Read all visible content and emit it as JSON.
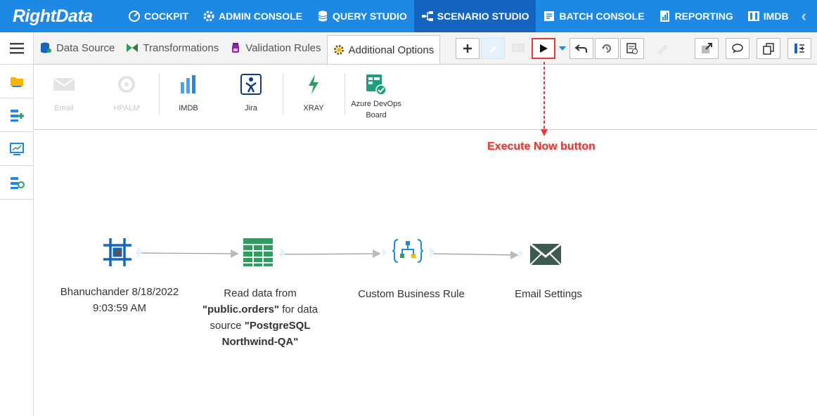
{
  "brand": {
    "name": "RightData"
  },
  "nav": {
    "items": [
      {
        "label": "COCKPIT",
        "icon": "gauge-icon"
      },
      {
        "label": "ADMIN CONSOLE",
        "icon": "gear-icon"
      },
      {
        "label": "QUERY STUDIO",
        "icon": "database-icon"
      },
      {
        "label": "SCENARIO STUDIO",
        "icon": "flow-icon",
        "active": true
      },
      {
        "label": "BATCH CONSOLE",
        "icon": "batch-icon"
      },
      {
        "label": "REPORTING",
        "icon": "report-icon"
      },
      {
        "label": "IMDB",
        "icon": "imdb-icon"
      }
    ],
    "collapse_glyph": "‹"
  },
  "tabs": [
    {
      "label": "Data Source",
      "icon": "database-icon"
    },
    {
      "label": "Transformations",
      "icon": "bowtie-icon"
    },
    {
      "label": "Validation Rules",
      "icon": "flask-icon"
    },
    {
      "label": "Additional Options",
      "icon": "gear-icon",
      "active": true
    }
  ],
  "options": [
    {
      "label": "Email",
      "icon": "email-icon",
      "enabled": false
    },
    {
      "label": "HPALM",
      "icon": "hpalm-icon",
      "enabled": false
    },
    {
      "label": "IMDB",
      "icon": "imdb-icon",
      "enabled": true
    },
    {
      "label": "Jira",
      "icon": "jira-icon",
      "enabled": true
    },
    {
      "label": "XRAY",
      "icon": "xray-icon",
      "enabled": true
    },
    {
      "label": "Azure DevOps Board",
      "label_line1": "Azure DevOps",
      "label_line2": "Board",
      "icon": "azure-devops-icon",
      "enabled": true
    }
  ],
  "annotation": {
    "text": "Execute Now button",
    "color": "#e53935"
  },
  "flow": {
    "nodes": [
      {
        "icon": "scenario-frame-icon",
        "label_line1": "Bhanuchander 8/18/2022",
        "label_line2": "9:03:59 AM"
      },
      {
        "icon": "table-icon",
        "label_prefix": "Read data from",
        "table": "\"public.orders\"",
        "mid": " for data source ",
        "source": "\"PostgreSQL Northwind-QA\""
      },
      {
        "icon": "business-rule-icon",
        "label": "Custom Business Rule"
      },
      {
        "icon": "envelope-icon",
        "label": "Email Settings"
      }
    ]
  },
  "colors": {
    "nav_bg": "#1e88e5",
    "nav_active": "#1565c0",
    "accent_green": "#2e9e5e",
    "node_blue": "#1565c0"
  }
}
